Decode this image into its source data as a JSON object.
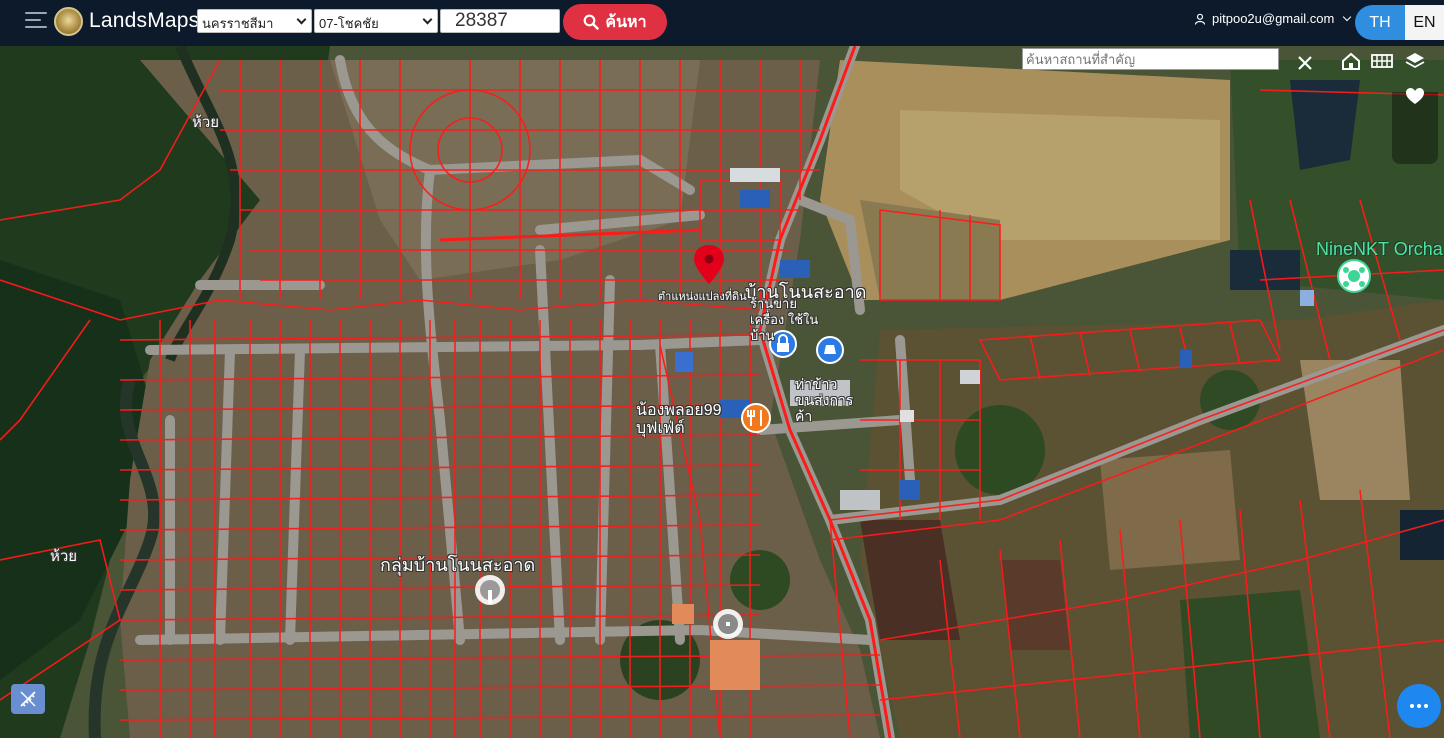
{
  "app": {
    "brand": "LandsMaps"
  },
  "search": {
    "province": "นครราชสีมา",
    "district": "07-โชคชัย",
    "parcel_number": "28387",
    "search_label": "ค้นหา"
  },
  "user": {
    "email": "pitpoo2u@gmail.com"
  },
  "language": {
    "th": "TH",
    "en": "EN"
  },
  "map": {
    "place_search_placeholder": "ค้นหาสถานที่สำคัญ",
    "labels": {
      "parcel_position": "ตำแหน่งแปลงที่ดิน",
      "village": "บ้านโนนสะอาด",
      "shop": "ร้านขายเครื่อง ใช้ในบ้าน",
      "pier": "ท่าข้าว ขนส่งการค้า",
      "restaurant": "น้องพลอย99 บุฟเฟ่ต์",
      "village_group": "กลุ่มบ้านโนนสะอาด",
      "orchard": "NineNKT Orcha",
      "water_1": "ห้วย",
      "water_2": "ห้วย"
    }
  },
  "colors": {
    "topbar": "#0c1a2c",
    "search_button": "#e03142",
    "lang_active": "#2f8ee0",
    "parcel_lines": "#ff1a1a",
    "fab": "#1e88f0"
  }
}
